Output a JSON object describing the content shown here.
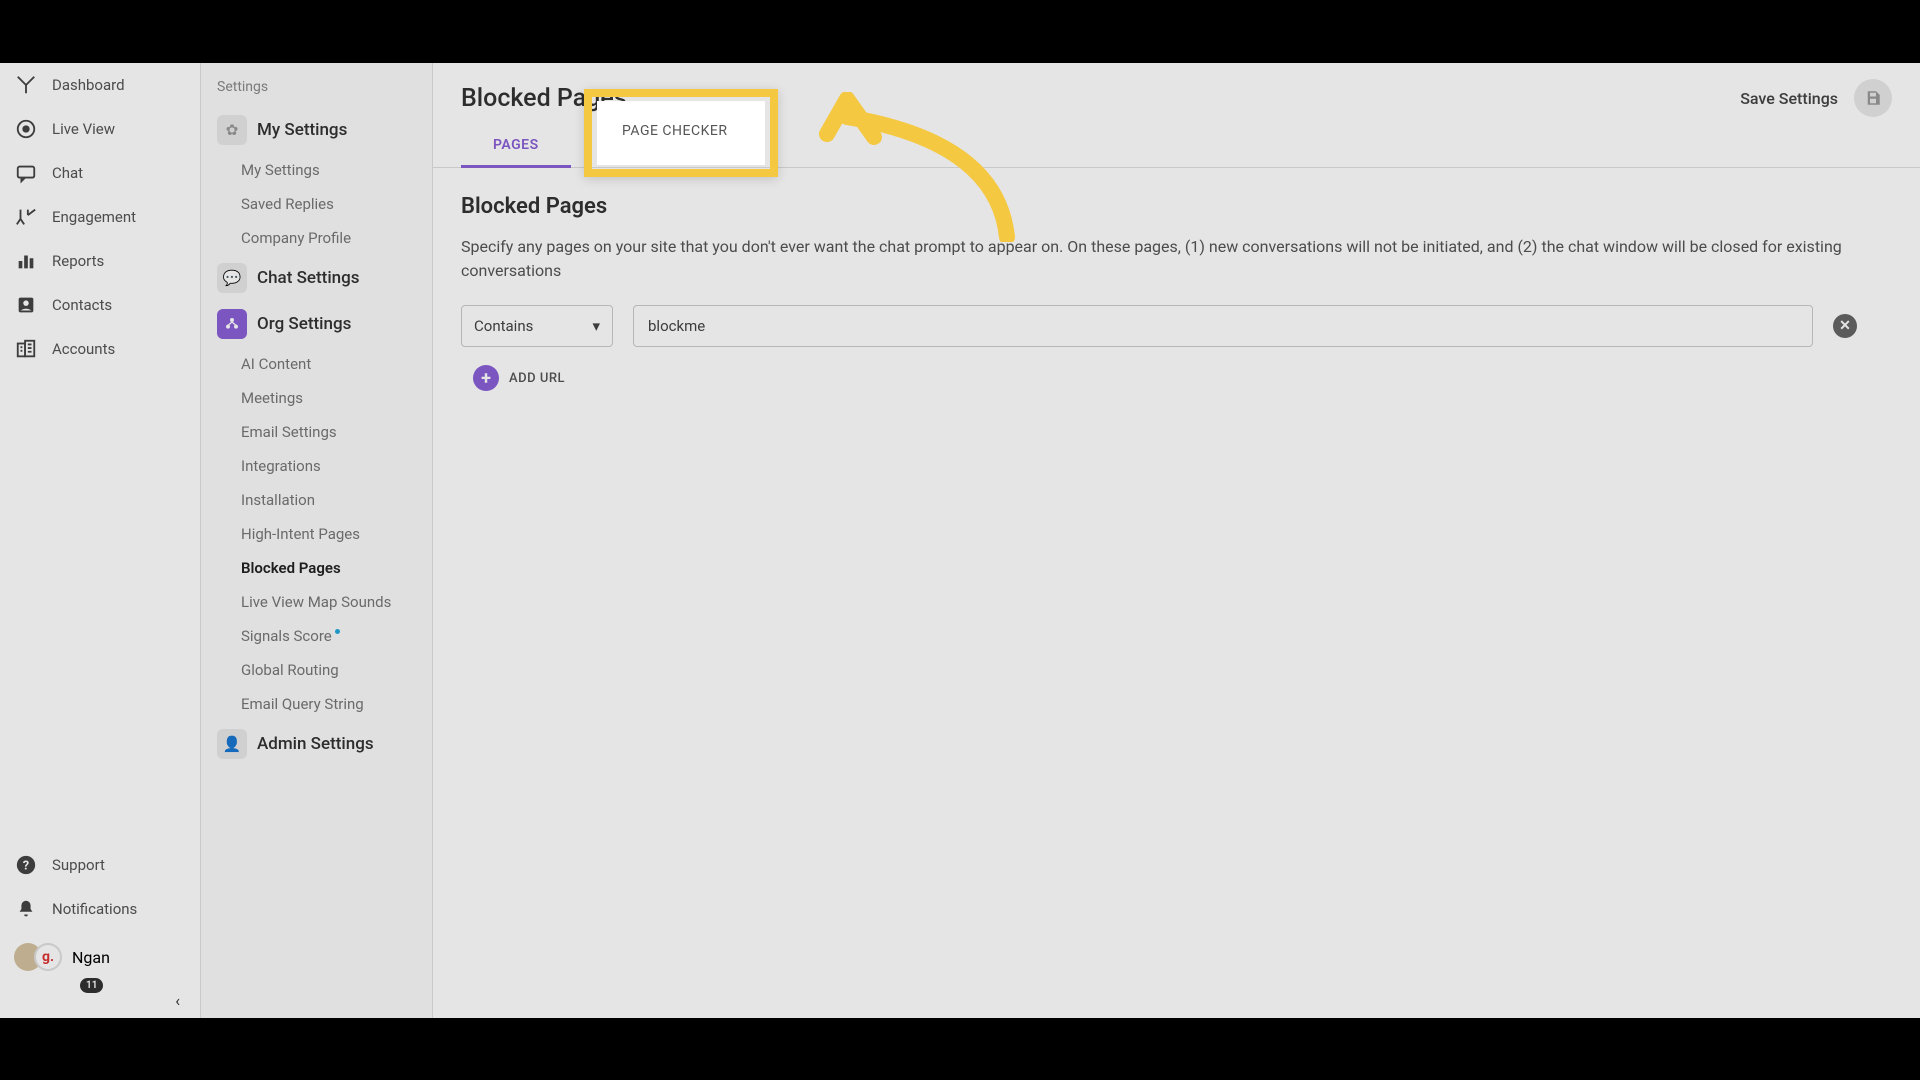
{
  "nav": {
    "items": [
      {
        "label": "Dashboard",
        "icon": "dashboard"
      },
      {
        "label": "Live View",
        "icon": "liveview"
      },
      {
        "label": "Chat",
        "icon": "chat"
      },
      {
        "label": "Engagement",
        "icon": "engagement"
      },
      {
        "label": "Reports",
        "icon": "reports"
      },
      {
        "label": "Contacts",
        "icon": "contacts"
      },
      {
        "label": "Accounts",
        "icon": "accounts"
      }
    ],
    "bottom": [
      {
        "label": "Support",
        "icon": "support"
      },
      {
        "label": "Notifications",
        "icon": "notifications"
      }
    ],
    "user": {
      "name": "Ngan",
      "badge": "11",
      "initial": "g."
    }
  },
  "settings_sidebar": {
    "header": "Settings",
    "groups": [
      {
        "label": "My Settings",
        "icon_style": "gray",
        "icon": "gear",
        "items": [
          "My Settings",
          "Saved Replies",
          "Company Profile"
        ]
      },
      {
        "label": "Chat Settings",
        "icon_style": "gray",
        "icon": "chat-set",
        "items": []
      },
      {
        "label": "Org Settings",
        "icon_style": "purple",
        "icon": "org",
        "items": [
          "AI Content",
          "Meetings",
          "Email Settings",
          "Integrations",
          "Installation",
          "High-Intent Pages",
          "Blocked Pages",
          "Live View Map Sounds",
          "Signals Score",
          "Global Routing",
          "Email Query String"
        ],
        "active_item": "Blocked Pages",
        "dot_item": "Signals Score"
      },
      {
        "label": "Admin Settings",
        "icon_style": "gray",
        "icon": "admin",
        "items": []
      }
    ]
  },
  "main": {
    "title": "Blocked Pages",
    "save_label": "Save Settings",
    "tabs": [
      "PAGES",
      "PAGE CHECKER"
    ],
    "active_tab": "PAGES",
    "section_title": "Blocked Pages",
    "description": "Specify any pages on your site that you don't ever want the chat prompt to appear on. On these pages, (1) new conversations will not be initiated, and (2) the chat window will be closed for existing conversations",
    "rows": [
      {
        "condition": "Contains",
        "value": "blockme"
      }
    ],
    "add_url_label": "ADD URL"
  },
  "colors": {
    "accent": "#8a5fd6",
    "highlight": "#f5c842"
  }
}
